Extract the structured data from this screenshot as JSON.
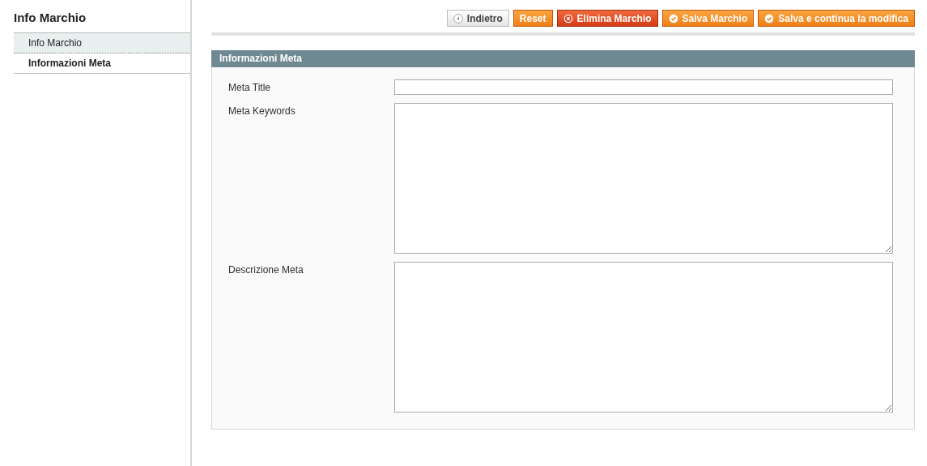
{
  "sidebar": {
    "title": "Info Marchio",
    "tabs": [
      {
        "label": "Info Marchio",
        "selected": false
      },
      {
        "label": "Informazioni Meta",
        "selected": true
      }
    ]
  },
  "buttons": [
    {
      "label": "Indietro",
      "kind": "back"
    },
    {
      "label": "Reset",
      "kind": "plain"
    },
    {
      "label": "Elimina Marchio",
      "kind": "delete"
    },
    {
      "label": "Salva Marchio",
      "kind": "save"
    },
    {
      "label": "Salva e continua la modifica",
      "kind": "save"
    }
  ],
  "section": {
    "title": "Informazioni Meta",
    "fields": [
      {
        "label": "Meta Title",
        "kind": "input"
      },
      {
        "label": "Meta Keywords",
        "kind": "textarea"
      },
      {
        "label": "Descrizione Meta",
        "kind": "textarea"
      }
    ]
  }
}
